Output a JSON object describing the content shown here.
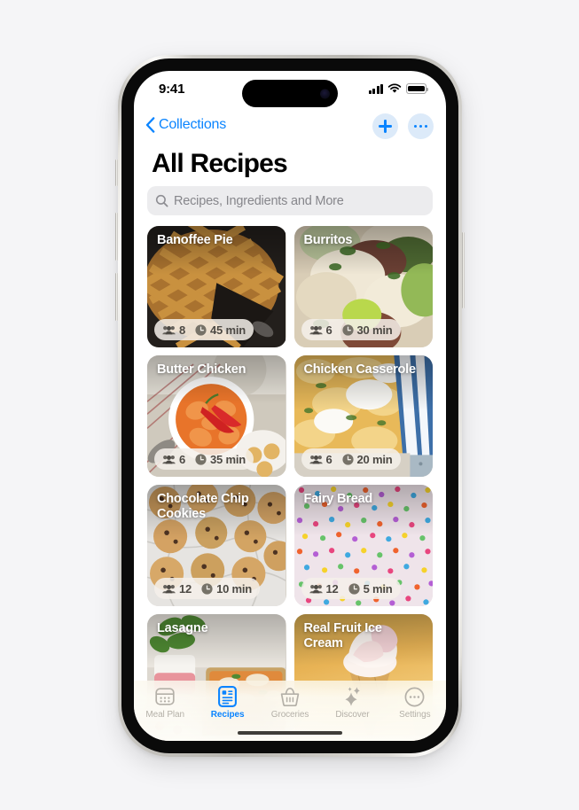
{
  "device": {
    "model_name": "iphone-pro"
  },
  "status_bar": {
    "time": "9:41",
    "signal_icon": "cellular-bars-icon",
    "wifi_icon": "wifi-icon",
    "battery_icon": "battery-full-icon"
  },
  "nav": {
    "back_label": "Collections",
    "back_icon": "chevron-left-icon",
    "add_icon": "plus-icon",
    "more_icon": "ellipsis-icon"
  },
  "page": {
    "title": "All Recipes"
  },
  "search": {
    "icon": "search-icon",
    "placeholder": "Recipes, Ingredients and More",
    "value": ""
  },
  "recipes": [
    {
      "title": "Banoffee Pie",
      "servings": "8",
      "time": "45 min",
      "servings_icon": "people-icon",
      "time_icon": "clock-icon",
      "image_name": "banoffee-pie-photo"
    },
    {
      "title": "Burritos",
      "servings": "6",
      "time": "30 min",
      "servings_icon": "people-icon",
      "time_icon": "clock-icon",
      "image_name": "burritos-photo"
    },
    {
      "title": "Butter Chicken",
      "servings": "6",
      "time": "35 min",
      "servings_icon": "people-icon",
      "time_icon": "clock-icon",
      "image_name": "butter-chicken-photo"
    },
    {
      "title": "Chicken Casserole",
      "servings": "6",
      "time": "20 min",
      "servings_icon": "people-icon",
      "time_icon": "clock-icon",
      "image_name": "chicken-casserole-photo"
    },
    {
      "title": "Chocolate Chip Cookies",
      "servings": "12",
      "time": "10 min",
      "servings_icon": "people-icon",
      "time_icon": "clock-icon",
      "image_name": "chocolate-chip-cookies-photo"
    },
    {
      "title": "Fairy Bread",
      "servings": "12",
      "time": "5 min",
      "servings_icon": "people-icon",
      "time_icon": "clock-icon",
      "image_name": "fairy-bread-photo"
    },
    {
      "title": "Lasagne",
      "servings": "",
      "time": "",
      "servings_icon": "people-icon",
      "time_icon": "clock-icon",
      "image_name": "lasagne-photo"
    },
    {
      "title": "Real Fruit Ice Cream",
      "servings": "",
      "time": "",
      "servings_icon": "people-icon",
      "time_icon": "clock-icon",
      "image_name": "real-fruit-ice-cream-photo"
    }
  ],
  "tabs": [
    {
      "label": "Meal Plan",
      "icon": "calendar-icon",
      "active": false
    },
    {
      "label": "Recipes",
      "icon": "recipe-card-icon",
      "active": true
    },
    {
      "label": "Groceries",
      "icon": "basket-icon",
      "active": false
    },
    {
      "label": "Discover",
      "icon": "sparkles-icon",
      "active": false
    },
    {
      "label": "Settings",
      "icon": "gear-circle-icon",
      "active": false
    }
  ],
  "colors": {
    "accent": "#0a84ff",
    "page_background": "#f5f5f7",
    "search_field": "#ececee",
    "inactive_tab": "#b4b0a8"
  }
}
